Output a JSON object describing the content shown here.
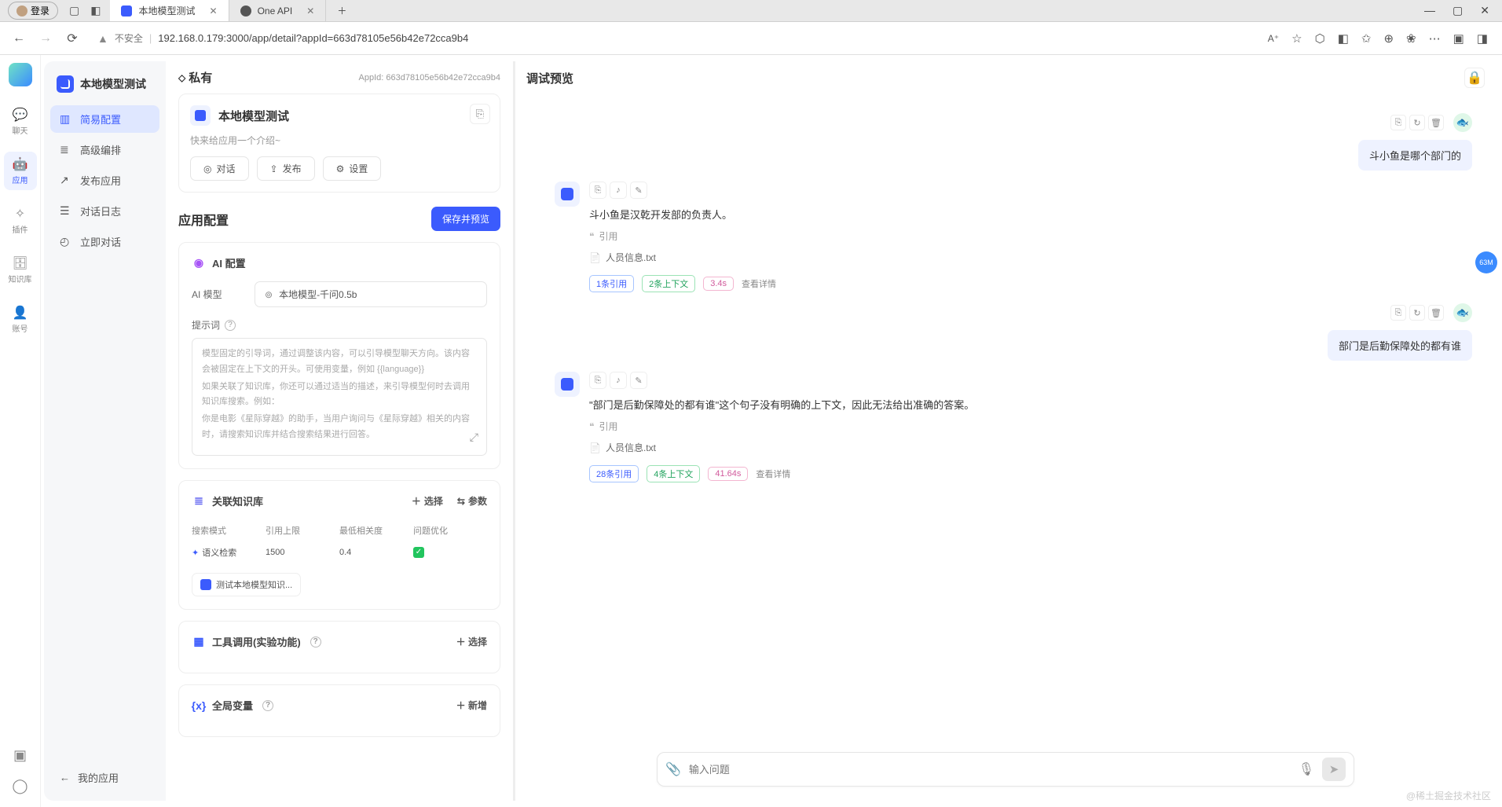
{
  "browser": {
    "login_label": "登录",
    "tabs": [
      {
        "title": "本地模型测试",
        "active": true
      },
      {
        "title": "One API",
        "active": false
      }
    ],
    "insecure_label": "不安全",
    "url": "192.168.0.179:3000/app/detail?appId=663d78105e56b42e72cca9b4"
  },
  "rail": {
    "items": [
      {
        "icon": "💬",
        "label": "聊天"
      },
      {
        "icon": "🤖",
        "label": "应用",
        "active": true
      },
      {
        "icon": "✧",
        "label": "插件"
      },
      {
        "icon": "🗄",
        "label": "知识库"
      },
      {
        "icon": "👤",
        "label": "账号"
      }
    ]
  },
  "sidebar": {
    "title": "本地模型测试",
    "items": [
      {
        "icon": "▥",
        "label": "简易配置",
        "active": true
      },
      {
        "icon": "≣",
        "label": "高级编排"
      },
      {
        "icon": "↗",
        "label": "发布应用"
      },
      {
        "icon": "☰",
        "label": "对话日志"
      },
      {
        "icon": "◴",
        "label": "立即对话"
      }
    ],
    "back_label": "我的应用"
  },
  "mid": {
    "private_label": "私有",
    "appid_label": "AppId: 663d78105e56b42e72cca9b4",
    "app_name": "本地模型测试",
    "app_desc": "快来给应用一个介绍~",
    "actions": {
      "chat": "对话",
      "publish": "发布",
      "settings": "设置"
    },
    "config_title": "应用配置",
    "save_btn": "保存并预览",
    "ai_config_title": "AI 配置",
    "model_label": "AI 模型",
    "model_value": "本地模型-千问0.5b",
    "prompt_label": "提示词",
    "prompt_placeholder": {
      "l1": "模型固定的引导词，通过调整该内容，可以引导模型聊天方向。该内容会被固定在上下文的开头。可使用变量，例如 {{language}}",
      "l2": "如果关联了知识库，你还可以通过适当的描述，来引导模型何时去调用知识库搜索。例如：",
      "l3": "你是电影《星际穿越》的助手，当用户询问与《星际穿越》相关的内容时，请搜索知识库并结合搜索结果进行回答。"
    },
    "kb_title": "关联知识库",
    "kb_select": "选择",
    "kb_params": "参数",
    "kb_table": {
      "h1": "搜索模式",
      "h2": "引用上限",
      "h3": "最低相关度",
      "h4": "问题优化",
      "v1": "语义检索",
      "v2": "1500",
      "v3": "0.4"
    },
    "kb_chip": "测试本地模型知识...",
    "tool_title": "工具调用(实验功能)",
    "tool_select": "选择",
    "var_title": "全局变量",
    "var_add": "新增"
  },
  "right": {
    "title": "调试预览",
    "messages": [
      {
        "role": "user",
        "text": "斗小鱼是哪个部门的"
      },
      {
        "role": "bot",
        "text": "斗小鱼是汉乾开发部的负责人。",
        "cite": "引用",
        "file": "人员信息.txt",
        "badges": [
          "1条引用",
          "2条上下文",
          "3.4s"
        ],
        "detail": "查看详情"
      },
      {
        "role": "user",
        "text": "部门是后勤保障处的都有谁"
      },
      {
        "role": "bot",
        "text": "\"部门是后勤保障处的都有谁\"这个句子没有明确的上下文，因此无法给出准确的答案。",
        "cite": "引用",
        "file": "人员信息.txt",
        "badges": [
          "28条引用",
          "4条上下文",
          "41.64s"
        ],
        "detail": "查看详情"
      }
    ],
    "input_placeholder": "输入问题"
  },
  "float_badge": "63M",
  "watermark": "@稀土掘金技术社区"
}
